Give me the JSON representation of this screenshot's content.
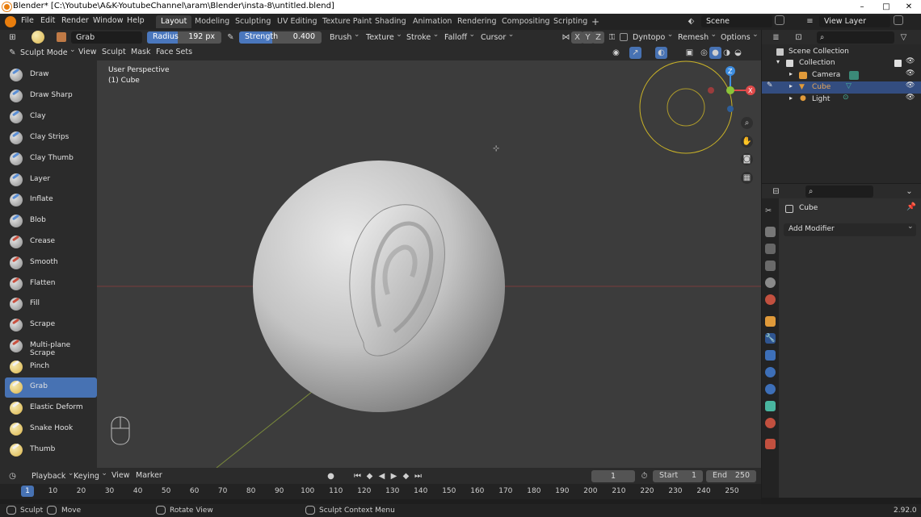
{
  "window": {
    "title": "Blender* [C:\\Youtube\\A&K-YoutubeChannel\\aram\\Blender\\insta-8\\untitled.blend]",
    "minimize": "–",
    "maximize": "□",
    "close": "✕"
  },
  "menus": [
    "File",
    "Edit",
    "Render",
    "Window",
    "Help"
  ],
  "workspaces": [
    "Layout",
    "Modeling",
    "Sculpting",
    "UV Editing",
    "Texture Paint",
    "Shading",
    "Animation",
    "Rendering",
    "Compositing",
    "Scripting"
  ],
  "active_workspace": "Layout",
  "add_workspace": "+",
  "scene": {
    "name": "Scene",
    "view_layer": "View Layer"
  },
  "tool_header": {
    "brush_name": "Grab",
    "radius_label": "Radius",
    "radius_value": "192 px",
    "strength_label": "Strength",
    "strength_value": "0.400",
    "strength_fraction": 0.4,
    "dropdowns": [
      "Brush",
      "Texture",
      "Stroke",
      "Falloff",
      "Cursor"
    ],
    "axes": [
      "X",
      "Y",
      "Z"
    ],
    "dyntopo": "Dyntopo",
    "remesh": "Remesh",
    "options": "Options"
  },
  "viewport_header": {
    "mode": "Sculpt Mode",
    "menus": [
      "View",
      "Sculpt",
      "Mask",
      "Face Sets"
    ]
  },
  "tools": [
    "Draw",
    "Draw Sharp",
    "Clay",
    "Clay Strips",
    "Clay Thumb",
    "Layer",
    "Inflate",
    "Blob",
    "Crease",
    "Smooth",
    "Flatten",
    "Fill",
    "Scrape",
    "Multi-plane Scrape",
    "Pinch",
    "Grab",
    "Elastic Deform",
    "Snake Hook",
    "Thumb"
  ],
  "active_tool": "Grab",
  "viewport": {
    "perspective": "User Perspective",
    "object": "(1) Cube",
    "gizmo_axes": [
      "Z",
      "X",
      "Y"
    ]
  },
  "outliner": {
    "scene_collection": "Scene Collection",
    "collection": "Collection",
    "items": [
      "Camera",
      "Cube",
      "Light"
    ],
    "selected": "Cube"
  },
  "properties": {
    "object": "Cube",
    "add_modifier": "Add Modifier"
  },
  "timeline": {
    "menus": [
      "Playback",
      "Keying",
      "View",
      "Marker"
    ],
    "current_frame": "1",
    "start_label": "Start",
    "start": "1",
    "end_label": "End",
    "end": "250",
    "ticks": [
      "1",
      "10",
      "20",
      "30",
      "40",
      "50",
      "60",
      "70",
      "80",
      "90",
      "100",
      "110",
      "120",
      "130",
      "140",
      "150",
      "160",
      "170",
      "180",
      "190",
      "200",
      "210",
      "220",
      "230",
      "240",
      "250"
    ]
  },
  "statusbar": {
    "items": [
      "Sculpt",
      "Move",
      "Rotate View",
      "Sculpt Context Menu"
    ],
    "version": "2.92.0"
  },
  "colors": {
    "accent": "#4772b3",
    "axis_x": "#e04a4a",
    "axis_y": "#8bc438",
    "axis_z": "#3d8de0",
    "sculpt_brush_ring": "#c9b227"
  }
}
